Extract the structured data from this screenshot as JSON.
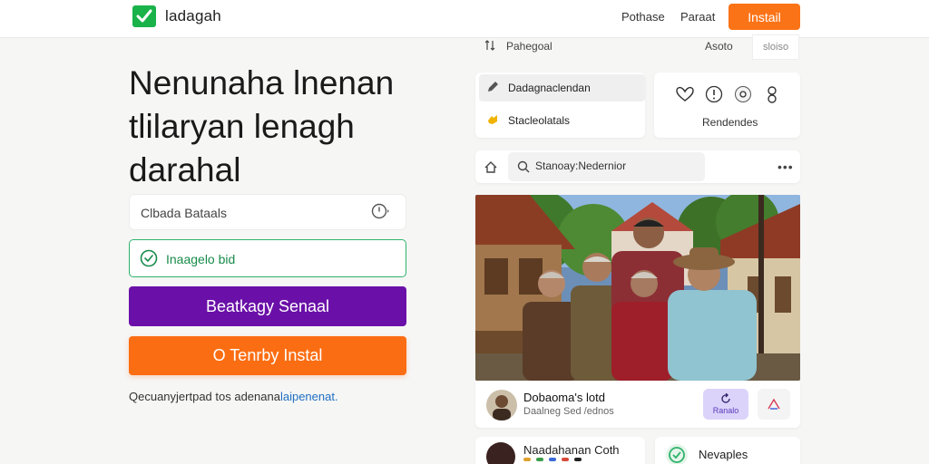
{
  "header": {
    "brand": "ladagah",
    "nav": [
      "Pothase",
      "Paraat"
    ],
    "install_label": "Instail",
    "install_color": "#fb7317"
  },
  "hero": {
    "title": "Nenunaha lnenan tlilaryan lenagh darahal",
    "search_placeholder": "Clbada Bataals",
    "green_field_label": "Inaagelo bid",
    "purple_button": "Beatkagy Senaal",
    "orange_button": "O Tenrby Instal",
    "footnote_text": "Qecuanyjertpad tos adenana",
    "footnote_link": "laipenenat."
  },
  "right": {
    "top_left_label": "Pahegoal",
    "top_right_label": "Asoto",
    "tiny_button_label": "sloiso",
    "side_items": [
      {
        "label": "Dadagnaclendan",
        "icon": "pencil-icon"
      },
      {
        "label": "Stacleolatals",
        "icon": "hand-icon"
      }
    ],
    "icons": [
      "heart-icon",
      "alert-icon",
      "at-icon",
      "user-icon"
    ],
    "resources_label": "Rendendes",
    "search_placeholder": "Stanoay:Nedernior",
    "profile": {
      "name": "Dobaoma's lotd",
      "subtitle": "Daalneg Sed /ednos",
      "lilac_label": "Ranalo"
    },
    "bottom_cards": [
      {
        "label": "Naadahanan Coth"
      },
      {
        "label": "Nevaples"
      }
    ]
  },
  "colors": {
    "brand_green": "#19b34a",
    "purple": "#6a0fa8",
    "orange": "#fb6d12",
    "success_green": "#2fb36b"
  }
}
